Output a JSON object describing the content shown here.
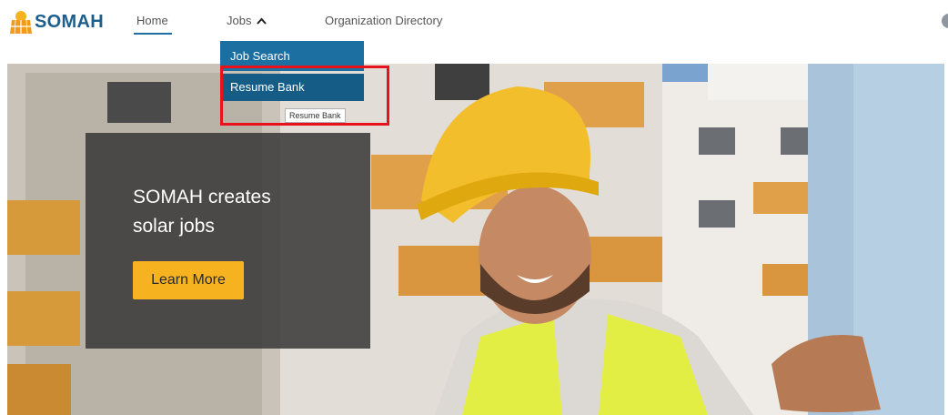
{
  "brand": {
    "name": "SOMAH"
  },
  "nav": {
    "home": "Home",
    "jobs": "Jobs",
    "org_directory": "Organization Directory"
  },
  "dropdown": {
    "items": [
      "Job Search",
      "Resume Bank"
    ],
    "tooltip": "Resume Bank"
  },
  "hero": {
    "headline_line1": "SOMAH creates",
    "headline_line2": "solar jobs",
    "cta": "Learn More"
  },
  "colors": {
    "brand_blue": "#1d5f8c",
    "dropdown_blue": "#1b6fa1",
    "cta_yellow": "#f6b21f",
    "highlight_red": "#e8121c"
  }
}
